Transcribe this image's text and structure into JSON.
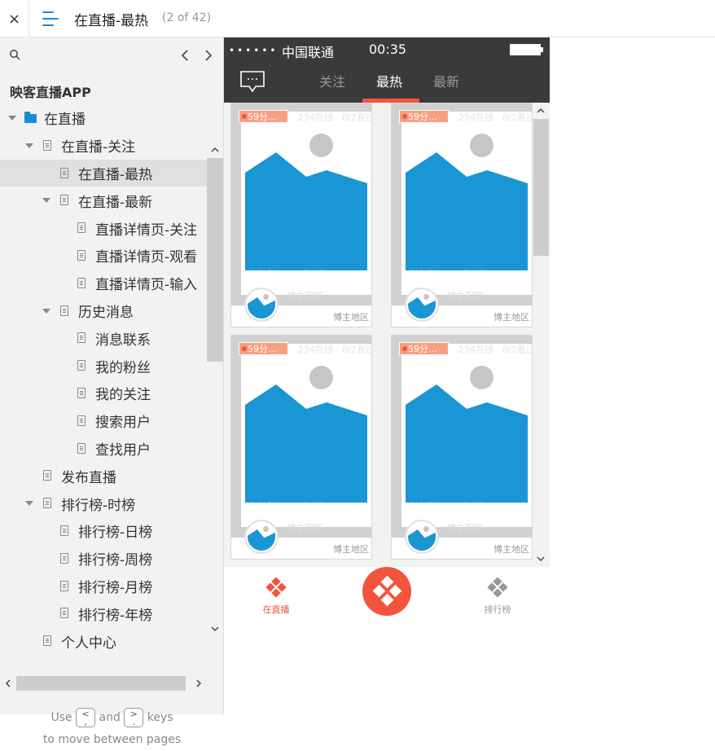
{
  "topbar": {
    "close_glyph": "×",
    "title": "在直播-最热",
    "page_count": "(2 of 42)"
  },
  "sidebar": {
    "project_title": "映客直播APP",
    "tree": [
      {
        "label": "在直播",
        "level": 0,
        "type": "folder",
        "expanded": true,
        "selected": false
      },
      {
        "label": "在直播-关注",
        "level": 1,
        "type": "page",
        "expanded": true,
        "selected": false
      },
      {
        "label": "在直播-最热",
        "level": 2,
        "type": "page",
        "expanded": false,
        "selected": true
      },
      {
        "label": "在直播-最新",
        "level": 2,
        "type": "page",
        "expanded": true,
        "selected": false
      },
      {
        "label": "直播详情页-关注",
        "level": 3,
        "type": "page",
        "expanded": false,
        "selected": false
      },
      {
        "label": "直播详情页-观看",
        "level": 3,
        "type": "page",
        "expanded": false,
        "selected": false
      },
      {
        "label": "直播详情页-输入",
        "level": 3,
        "type": "page",
        "expanded": false,
        "selected": false
      },
      {
        "label": "历史消息",
        "level": 2,
        "type": "page",
        "expanded": true,
        "selected": false
      },
      {
        "label": "消息联系",
        "level": 3,
        "type": "page",
        "expanded": false,
        "selected": false
      },
      {
        "label": "我的粉丝",
        "level": 3,
        "type": "page",
        "expanded": false,
        "selected": false
      },
      {
        "label": "我的关注",
        "level": 3,
        "type": "page",
        "expanded": false,
        "selected": false
      },
      {
        "label": "搜索用户",
        "level": 3,
        "type": "page",
        "expanded": false,
        "selected": false
      },
      {
        "label": "查找用户",
        "level": 3,
        "type": "page",
        "expanded": false,
        "selected": false
      },
      {
        "label": "发布直播",
        "level": 1,
        "type": "page",
        "expanded": false,
        "selected": false
      },
      {
        "label": "排行榜-时榜",
        "level": 1,
        "type": "page",
        "expanded": true,
        "selected": false
      },
      {
        "label": "排行榜-日榜",
        "level": 2,
        "type": "page",
        "expanded": false,
        "selected": false
      },
      {
        "label": "排行榜-周榜",
        "level": 2,
        "type": "page",
        "expanded": false,
        "selected": false
      },
      {
        "label": "排行榜-月榜",
        "level": 2,
        "type": "page",
        "expanded": false,
        "selected": false
      },
      {
        "label": "排行榜-年榜",
        "level": 2,
        "type": "page",
        "expanded": false,
        "selected": false
      },
      {
        "label": "个人中心",
        "level": 1,
        "type": "page",
        "expanded": false,
        "selected": false
      }
    ],
    "hint": {
      "use": "Use",
      "key_prev": "<\n,",
      "and": "and",
      "key_next": ">\n.",
      "keys": "keys",
      "line2": "to move between pages"
    }
  },
  "phone": {
    "status": {
      "dots": "••••••",
      "carrier": "中国联通",
      "time": "00:35"
    },
    "tabs": [
      {
        "label": "关注",
        "active": false
      },
      {
        "label": "最热",
        "active": true
      },
      {
        "label": "最新",
        "active": false
      }
    ],
    "cards": [
      {
        "badge": "59分...",
        "watch": "234在线 · 8t2看过",
        "title": "直播主题名称",
        "host": "博主昵称",
        "region": "博主地区"
      },
      {
        "badge": "59分...",
        "watch": "234在线 · 8t2看过",
        "title": "直播主题名称",
        "host": "博主昵称",
        "region": "博主地区"
      },
      {
        "badge": "59分...",
        "watch": "234在线 · 8t2看过",
        "title": "直播主题名称",
        "host": "博主昵称",
        "region": "博主地区"
      },
      {
        "badge": "59分...",
        "watch": "234在线 · 8t2看过",
        "title": "直播主题名称",
        "host": "博主昵称",
        "region": "博主地区"
      }
    ],
    "bottom_nav": {
      "left_label": "在直播",
      "right_label": "排行榜"
    },
    "colors": {
      "accent": "#f4543d",
      "nav_bg": "#3a3a3a",
      "image_blue": "#1a96d4",
      "inactive_gray": "#999999"
    }
  }
}
